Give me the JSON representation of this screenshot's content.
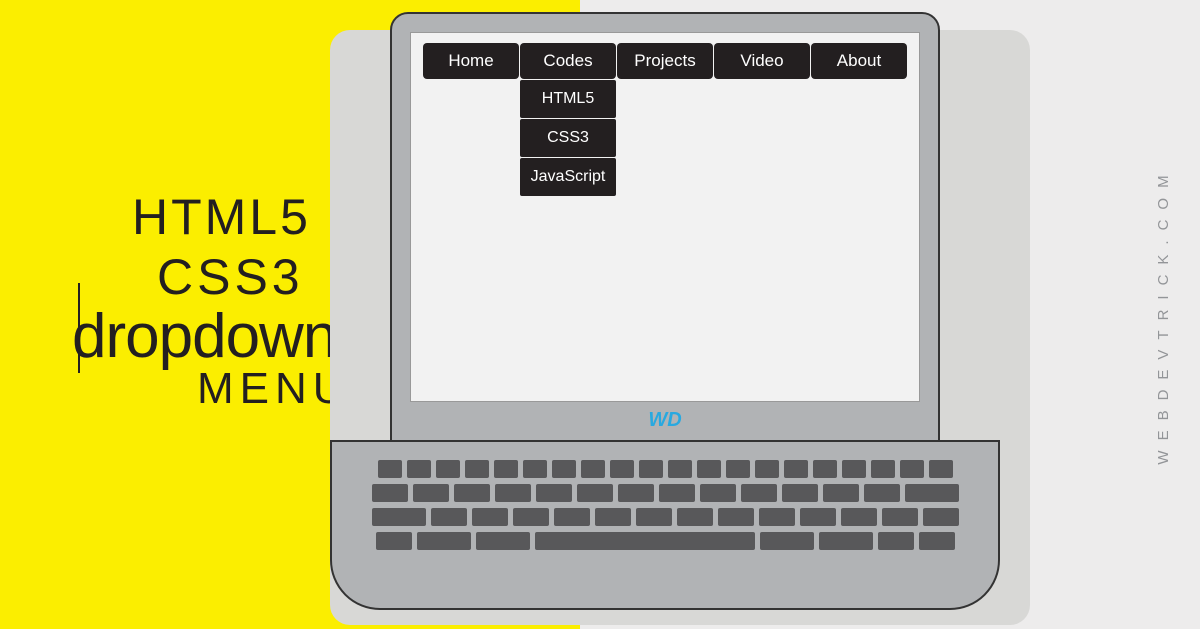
{
  "title": {
    "line1": "HTML5",
    "line2": "CSS3",
    "line3": "dropdown",
    "line4": "MENU"
  },
  "menu": {
    "items": [
      {
        "label": "Home"
      },
      {
        "label": "Codes"
      },
      {
        "label": "Projects"
      },
      {
        "label": "Video"
      },
      {
        "label": "About"
      }
    ],
    "dropdown": [
      {
        "label": "HTML5"
      },
      {
        "label": "CSS3"
      },
      {
        "label": "JavaScript"
      }
    ]
  },
  "logo": "WD",
  "siteUrl": "WEBDEVTRICK.COM"
}
